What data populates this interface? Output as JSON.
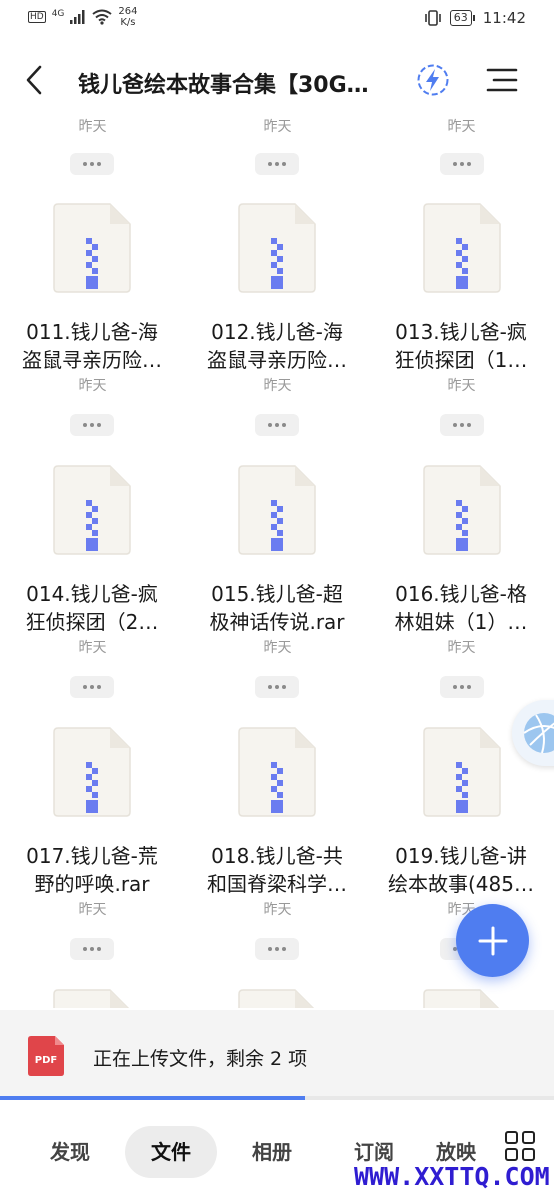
{
  "status": {
    "hd": "HD",
    "signal": "4G",
    "speed_value": "264",
    "speed_unit": "K/s",
    "battery": "63",
    "time": "11:42"
  },
  "header": {
    "title": "钱儿爸绘本故事合集【30G…",
    "back_icon": "back-arrow-icon",
    "boost_icon": "lightning-icon",
    "menu_icon": "menu-icon"
  },
  "top_partial": {
    "dates": [
      "昨天",
      "昨天",
      "昨天"
    ]
  },
  "files": [
    {
      "line1": "011.钱儿爸-海",
      "line2": "盗鼠寻亲历险…",
      "date": "昨天"
    },
    {
      "line1": "012.钱儿爸-海",
      "line2": "盗鼠寻亲历险…",
      "date": "昨天"
    },
    {
      "line1": "013.钱儿爸-疯",
      "line2": "狂侦探团（1…",
      "date": "昨天"
    },
    {
      "line1": "014.钱儿爸-疯",
      "line2": "狂侦探团（2…",
      "date": "昨天"
    },
    {
      "line1": "015.钱儿爸-超",
      "line2": "极神话传说.rar",
      "date": "昨天"
    },
    {
      "line1": "016.钱儿爸-格",
      "line2": "林姐妹（1）…",
      "date": "昨天"
    },
    {
      "line1": "017.钱儿爸-荒",
      "line2": "野的呼唤.rar",
      "date": "昨天"
    },
    {
      "line1": "018.钱儿爸-共",
      "line2": "和国脊梁科学…",
      "date": "昨天"
    },
    {
      "line1": "019.钱儿爸-讲",
      "line2": "绘本故事(485…",
      "date": "昨天"
    }
  ],
  "upload": {
    "text": "正在上传文件，剩余 2 项",
    "icon_label": "PDF",
    "progress": 0.55
  },
  "nav": {
    "tabs": [
      "发现",
      "文件",
      "相册",
      "订阅",
      "放映"
    ],
    "active": "文件"
  },
  "watermark": "WWW.XXTTQ.COM",
  "colors": {
    "accent": "#4f7df0",
    "zip_stripe": "#6a7cf0",
    "pdf_red": "#e0454a",
    "watermark": "#2f1dd1"
  }
}
